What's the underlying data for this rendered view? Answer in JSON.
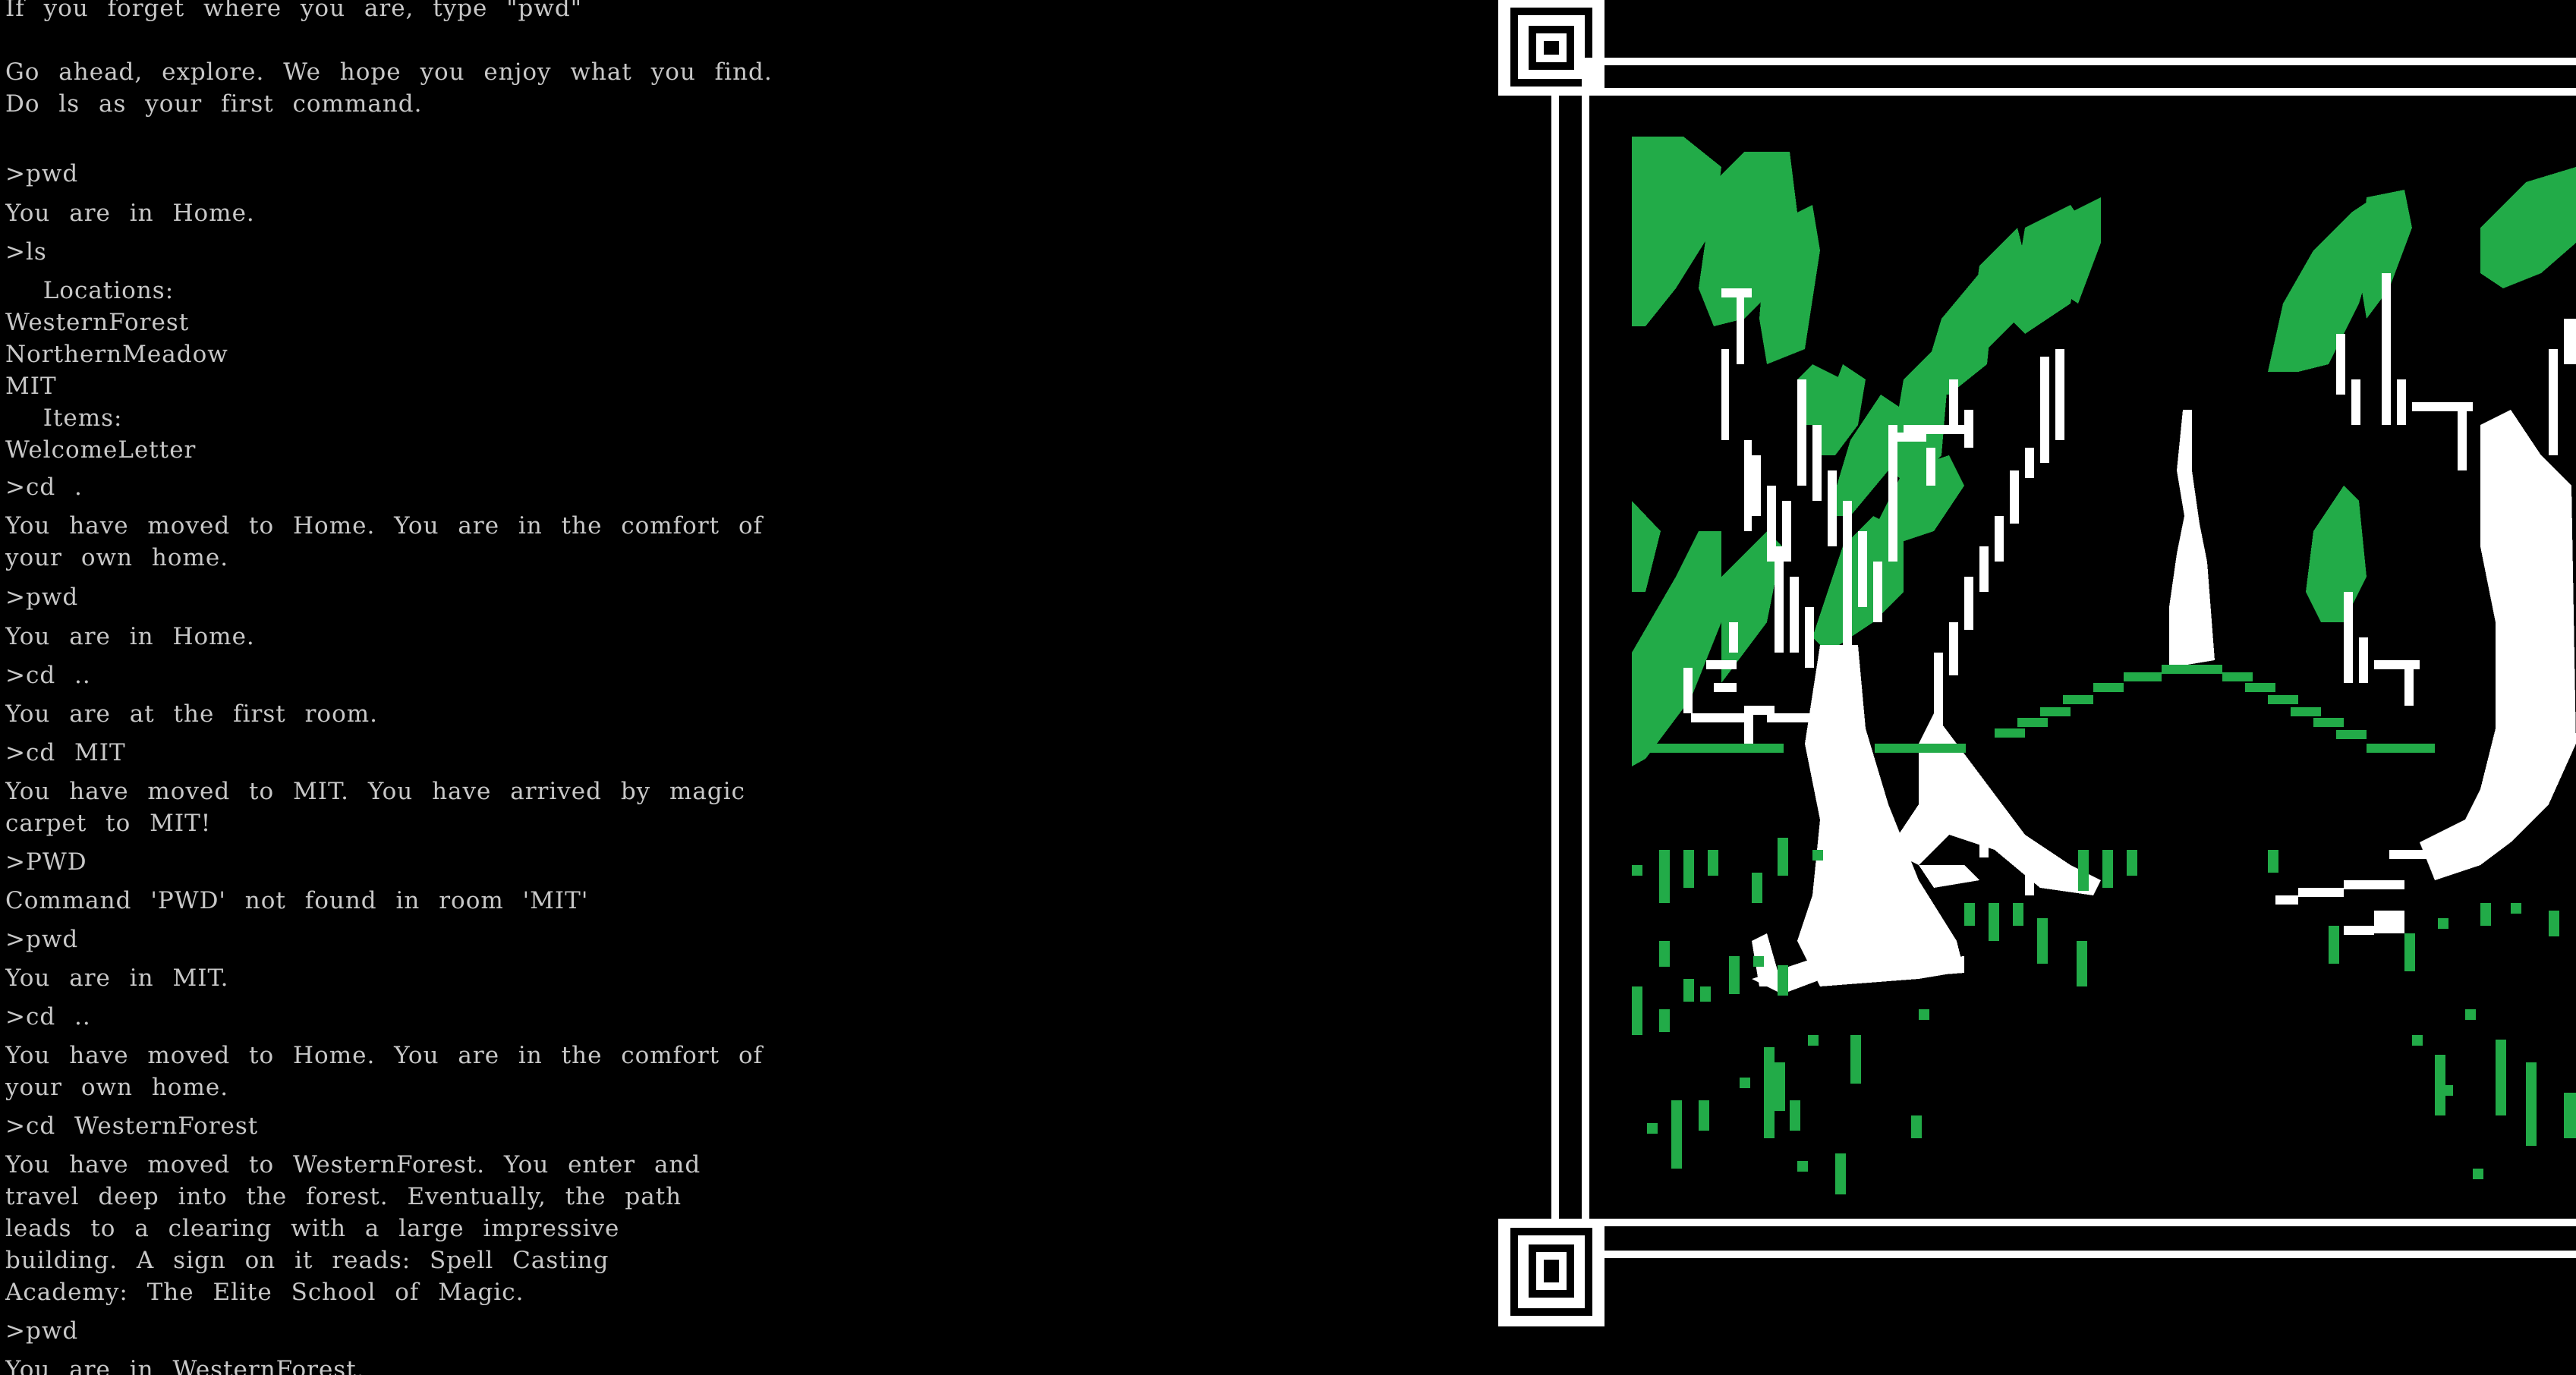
{
  "terminal": {
    "lines": [
      "If you forget where you are, type \"pwd\"",
      "",
      "Go ahead, explore. We hope you enjoy what you find.",
      "Do ls as your first command.",
      "",
      ">pwd",
      "You are in Home.",
      ">ls",
      "  Locations:",
      "WesternForest",
      "NorthernMeadow",
      "MIT",
      "  Items:",
      "WelcomeLetter",
      ">cd .",
      "You have moved to Home. You are in the comfort of",
      "your own home.",
      ">pwd",
      "You are in Home.",
      ">cd ..",
      "You are at the first room.",
      ">cd MIT",
      "You have moved to MIT. You have arrived by magic",
      "carpet to MIT!",
      ">PWD",
      "Command 'PWD' not found in room 'MIT'",
      ">pwd",
      "You are in MIT.",
      ">cd ..",
      "You have moved to Home. You are in the comfort of",
      "your own home.",
      ">cd WesternForest",
      "You have moved to WesternForest. You enter and",
      "travel deep into the forest. Eventually, the path",
      "leads to a clearing with a large impressive",
      "building. A sign on it reads: Spell Casting",
      "Academy: The Elite School of Magic.",
      ">pwd",
      "You are in WesternForest."
    ]
  },
  "art": {
    "scene": "forest-illustration",
    "colors": {
      "background": "#000000",
      "frame": "#ffffff",
      "foliage": "#22ab48",
      "trunk": "#ffffff",
      "text": "#c8c8c8"
    }
  }
}
